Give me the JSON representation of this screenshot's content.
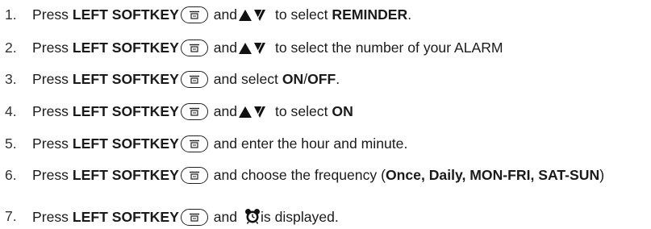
{
  "steps": [
    {
      "num": "1.",
      "a": "Press ",
      "b": "LEFT SOFTKEY",
      "c": " and",
      "d": " to select ",
      "e": "REMINDER",
      "f": "."
    },
    {
      "num": "2.",
      "a": "Press ",
      "b": "LEFT SOFTKEY",
      "c": " and",
      "d": " to select the number of your ALARM"
    },
    {
      "num": "3.",
      "a": "Press ",
      "b": "LEFT SOFTKEY",
      "c": " and select ",
      "d": "ON",
      "e": "/",
      "f": "OFF",
      "g": "."
    },
    {
      "num": "4.",
      "a": "Press ",
      "b": "LEFT SOFTKEY",
      "c": " and",
      "d": " to select ",
      "e": "ON"
    },
    {
      "num": "5.",
      "a": "Press ",
      "b": "LEFT SOFTKEY",
      "c": " and enter the hour and minute."
    },
    {
      "num": "6.",
      "a": "Press ",
      "b": "LEFT SOFTKEY",
      "c": " and choose the frequency (",
      "d": "Once, Daily, MON-FRI, SAT-SUN",
      "e": ")"
    },
    {
      "num": "7.",
      "a": "Press ",
      "b": "LEFT SOFTKEY",
      "c": " and ",
      "d": "is displayed."
    }
  ],
  "icons": {
    "softkey": "left-softkey-icon",
    "nav": "up-down-arrows-icon",
    "alarm": "alarm-clock-icon"
  }
}
